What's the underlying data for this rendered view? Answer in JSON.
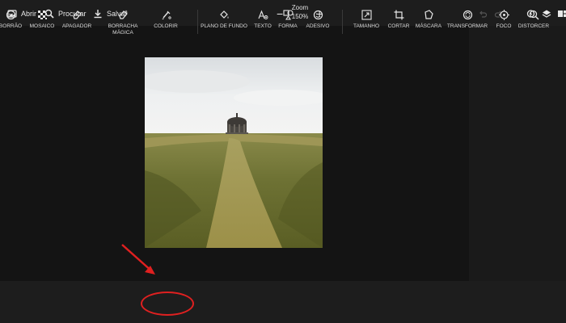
{
  "topbar": {
    "open_label": "Abrir",
    "search_label": "Procurar",
    "save_label": "Salvar",
    "zoom_label": "Zoom",
    "zoom_value": "150%",
    "zoom_minus": "−",
    "zoom_plus": "+"
  },
  "toolbar": {
    "items": [
      {
        "label": "BORRÃO",
        "icon": "blur-icon"
      },
      {
        "label": "MOSAICO",
        "icon": "mosaic-icon"
      },
      {
        "label": "APAGADOR",
        "icon": "eraser-icon"
      },
      {
        "label": "BORRACHA\nMÁGICA",
        "icon": "magic-eraser-icon"
      },
      {
        "label": "COLORIR",
        "icon": "colorize-icon"
      },
      {
        "label": "PLANO DE FUNDO",
        "icon": "background-icon"
      },
      {
        "label": "TEXTO",
        "icon": "text-icon"
      },
      {
        "label": "FORMA",
        "icon": "shape-icon"
      },
      {
        "label": "ADESIVO",
        "icon": "sticker-icon"
      },
      {
        "label": "TAMANHO",
        "icon": "resize-icon"
      },
      {
        "label": "CORTAR",
        "icon": "crop-icon"
      },
      {
        "label": "MÁSCARA",
        "icon": "mask-icon"
      },
      {
        "label": "TRANSFORMAR",
        "icon": "transform-icon"
      },
      {
        "label": "FOCO",
        "icon": "focus-icon"
      },
      {
        "label": "DISTORCER",
        "icon": "distort-icon"
      }
    ]
  },
  "colors": {
    "background": "#141414",
    "bar": "#1d1d1d",
    "annotation": "#e02020"
  }
}
